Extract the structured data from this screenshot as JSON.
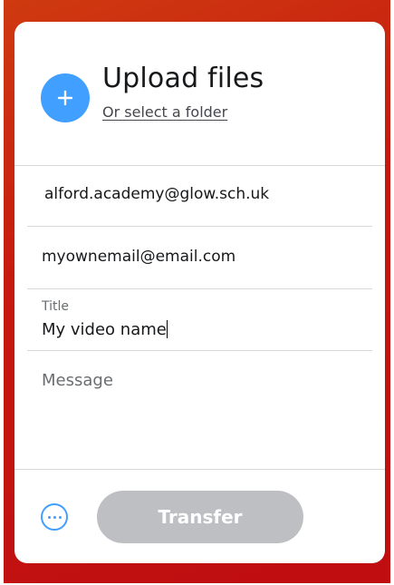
{
  "upload": {
    "title": "Upload files",
    "folder_link": "Or select a folder"
  },
  "form": {
    "to_email": "alford.academy@glow.sch.uk",
    "your_email": "myownemail@email.com",
    "title_label": "Title",
    "title_value": "My video name",
    "message_placeholder": "Message"
  },
  "footer": {
    "transfer_label": "Transfer"
  },
  "colors": {
    "accent": "#409fff",
    "disabled_button": "#bebfc2",
    "background": "#c6190f"
  }
}
